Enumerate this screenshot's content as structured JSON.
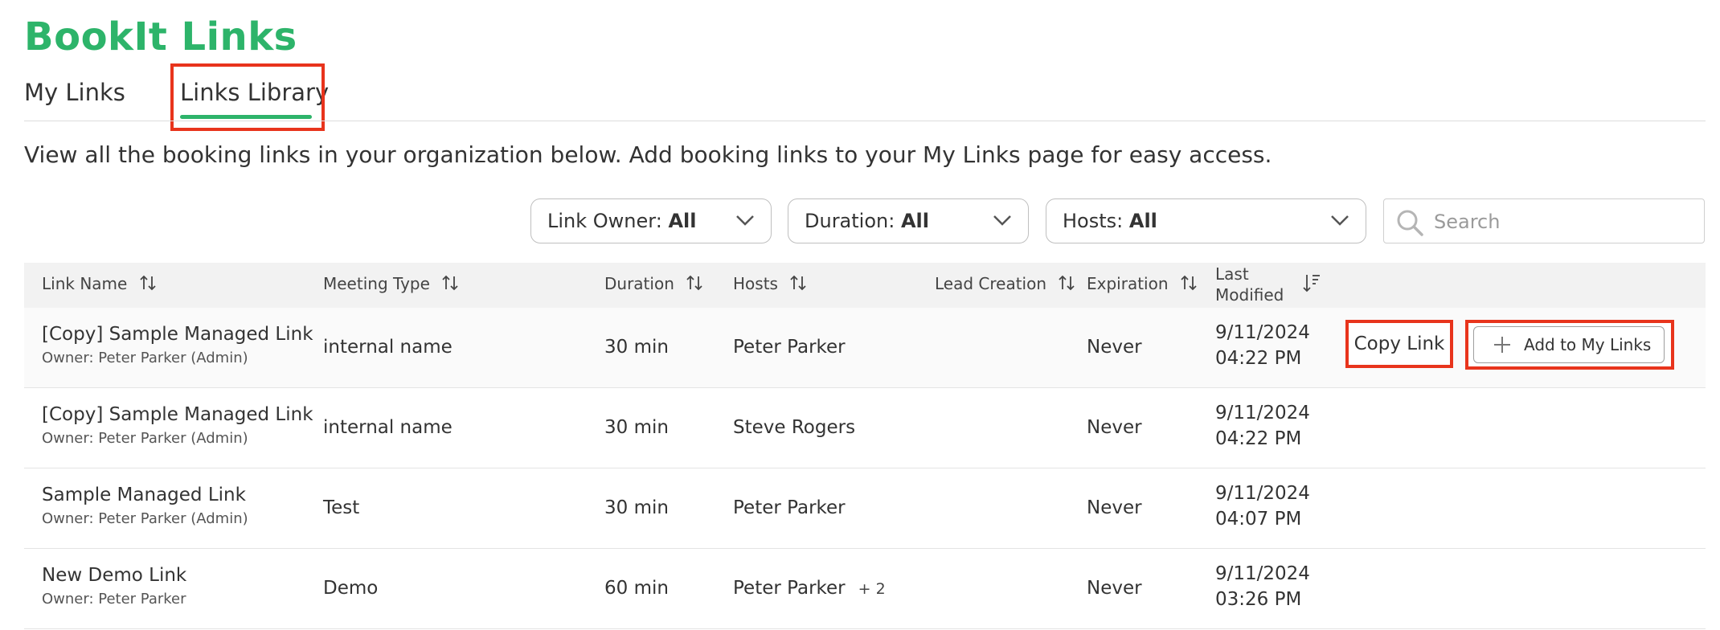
{
  "app_title": "BookIt Links",
  "tabs": [
    {
      "label": "My Links",
      "active": false
    },
    {
      "label": "Links Library",
      "active": true
    }
  ],
  "description": "View all the booking links in your organization below. Add booking links to your My Links page for easy access.",
  "filters": {
    "owner": {
      "label": "Link Owner:",
      "value": "All"
    },
    "duration": {
      "label": "Duration:",
      "value": "All"
    },
    "hosts": {
      "label": "Hosts:",
      "value": "All"
    }
  },
  "search": {
    "placeholder": "Search",
    "value": ""
  },
  "table": {
    "headers": {
      "link_name": "Link Name",
      "meeting_type": "Meeting Type",
      "duration": "Duration",
      "hosts": "Hosts",
      "lead_creation": "Lead Creation",
      "expiration": "Expiration",
      "last_modified_1": "Last",
      "last_modified_2": "Modified"
    },
    "rows": [
      {
        "name": "[Copy] Sample Managed Link",
        "owner": "Owner: Peter Parker (Admin)",
        "meeting_type": "internal name",
        "duration": "30 min",
        "hosts": "Peter Parker",
        "extra_hosts": "",
        "lead_creation": "",
        "expiration": "Never",
        "date": "9/11/2024",
        "time": "04:22 PM"
      },
      {
        "name": "[Copy] Sample Managed Link",
        "owner": "Owner: Peter Parker (Admin)",
        "meeting_type": "internal name",
        "duration": "30 min",
        "hosts": "Steve Rogers",
        "extra_hosts": "",
        "lead_creation": "",
        "expiration": "Never",
        "date": "9/11/2024",
        "time": "04:22 PM"
      },
      {
        "name": "Sample Managed Link",
        "owner": "Owner: Peter Parker (Admin)",
        "meeting_type": "Test",
        "duration": "30 min",
        "hosts": "Peter Parker",
        "extra_hosts": "",
        "lead_creation": "",
        "expiration": "Never",
        "date": "9/11/2024",
        "time": "04:07 PM"
      },
      {
        "name": "New Demo Link",
        "owner": "Owner: Peter Parker",
        "meeting_type": "Demo",
        "duration": "60 min",
        "hosts": "Peter Parker",
        "extra_hosts": "+ 2",
        "lead_creation": "",
        "expiration": "Never",
        "date": "9/11/2024",
        "time": "03:26 PM"
      }
    ]
  },
  "actions": {
    "copy_link": "Copy Link",
    "add_to_my_links": "Add to My Links"
  },
  "colors": {
    "brand": "#2db46a",
    "highlight": "#e8341c"
  },
  "icons": {
    "sort": "sort-arrows-icon",
    "sort_active": "sort-descending-icon",
    "dropdown": "chevron-down-icon",
    "search": "search-icon",
    "add": "plus-icon"
  }
}
